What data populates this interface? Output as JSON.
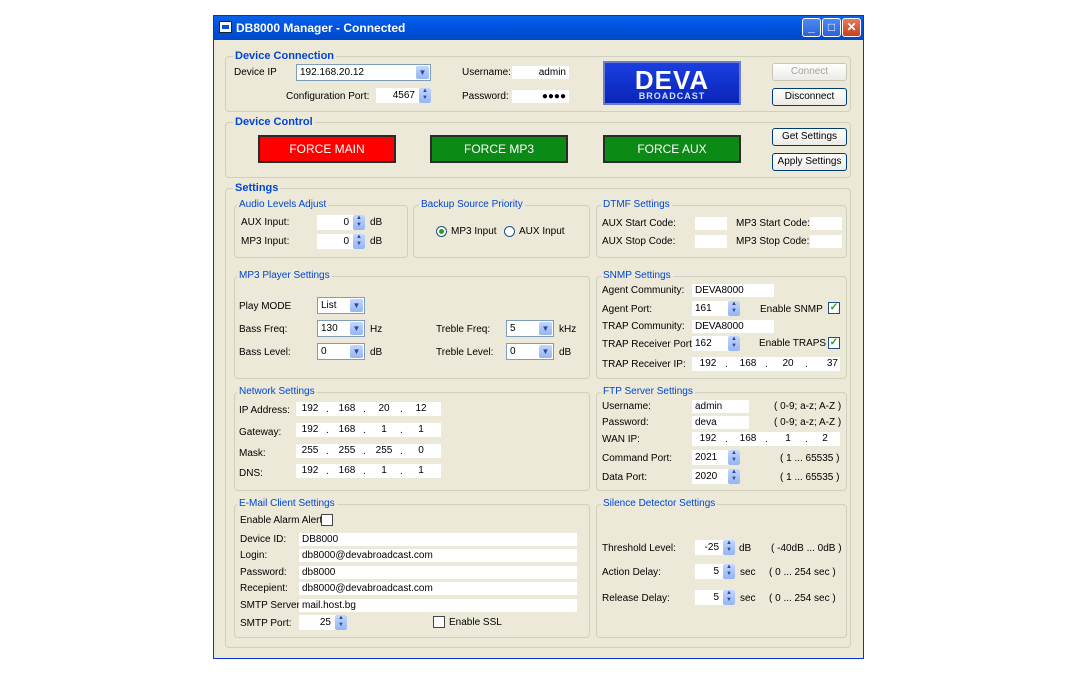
{
  "window": {
    "title": "DB8000 Manager - Connected"
  },
  "connection": {
    "heading": "Device Connection",
    "device_ip_label": "Device IP",
    "device_ip": "192.168.20.12",
    "config_port_label": "Configuration Port:",
    "config_port": "4567",
    "username_label": "Username:",
    "username": "admin",
    "password_label": "Password:",
    "password": "●●●●",
    "connect": "Connect",
    "disconnect": "Disconnect",
    "logo_main": "DEVA",
    "logo_sub": "BROADCAST"
  },
  "control": {
    "heading": "Device Control",
    "force_main": "FORCE MAIN",
    "force_mp3": "FORCE MP3",
    "force_aux": "FORCE AUX",
    "get_settings": "Get Settings",
    "apply_settings": "Apply Settings",
    "colors": {
      "main": "#ff0000",
      "mp3": "#0c8a16",
      "aux": "#0c8a16"
    }
  },
  "settings": {
    "heading": "Settings"
  },
  "audio": {
    "heading": "Audio Levels Adjust",
    "aux_label": "AUX Input:",
    "aux_value": "0",
    "mp3_label": "MP3 Input:",
    "mp3_value": "0",
    "unit": "dB"
  },
  "backup": {
    "heading": "Backup Source Priority",
    "mp3": "MP3 Input",
    "aux": "AUX Input",
    "selected": "MP3 Input"
  },
  "dtmf": {
    "heading": "DTMF Settings",
    "aux_start": "AUX Start Code:",
    "aux_stop": "AUX Stop Code:",
    "mp3_start": "MP3 Start Code:",
    "mp3_stop": "MP3 Stop Code:"
  },
  "mp3player": {
    "heading": "MP3 Player Settings",
    "play_mode_label": "Play MODE",
    "play_mode": "List",
    "bass_freq_label": "Bass Freq:",
    "bass_freq": "130",
    "bass_freq_unit": "Hz",
    "bass_level_label": "Bass Level:",
    "bass_level": "0",
    "bass_level_unit": "dB",
    "treble_freq_label": "Treble Freq:",
    "treble_freq": "5",
    "treble_freq_unit": "kHz",
    "treble_level_label": "Treble Level:",
    "treble_level": "0",
    "treble_level_unit": "dB"
  },
  "snmp": {
    "heading": "SNMP Settings",
    "agent_community_label": "Agent Community:",
    "agent_community": "DEVA8000",
    "agent_port_label": "Agent Port:",
    "agent_port": "161",
    "enable_snmp": "Enable SNMP",
    "trap_community_label": "TRAP Community:",
    "trap_community": "DEVA8000",
    "trap_port_label": "TRAP Receiver Port:",
    "trap_port": "162",
    "enable_traps": "Enable TRAPS",
    "trap_ip_label": "TRAP Receiver IP:",
    "trap_ip": [
      "192",
      "168",
      "20",
      "37"
    ]
  },
  "network": {
    "heading": "Network Settings",
    "ip_label": "IP Address:",
    "ip": [
      "192",
      "168",
      "20",
      "12"
    ],
    "gw_label": "Gateway:",
    "gw": [
      "192",
      "168",
      "1",
      "1"
    ],
    "mask_label": "Mask:",
    "mask": [
      "255",
      "255",
      "255",
      "0"
    ],
    "dns_label": "DNS:",
    "dns": [
      "192",
      "168",
      "1",
      "1"
    ]
  },
  "ftp": {
    "heading": "FTP Server Settings",
    "username_label": "Username:",
    "username": "admin",
    "username_hint": "( 0-9; a-z; A-Z )",
    "password_label": "Password:",
    "password": "deva",
    "password_hint": "( 0-9; a-z; A-Z )",
    "wan_label": "WAN IP:",
    "wan": [
      "192",
      "168",
      "1",
      "2"
    ],
    "cmd_port_label": "Command Port:",
    "cmd_port": "2021",
    "cmd_port_hint": "( 1 ... 65535 )",
    "data_port_label": "Data Port:",
    "data_port": "2020",
    "data_port_hint": "( 1 ... 65535 )"
  },
  "email": {
    "heading": "E-Mail Client Settings",
    "enable_alarm": "Enable Alarm Alert",
    "device_id_label": "Device ID:",
    "device_id": "DB8000",
    "login_label": "Login:",
    "login": "db8000@devabroadcast.com",
    "password_label": "Password:",
    "password": "db8000",
    "recipient_label": "Recepient:",
    "recipient": "db8000@devabroadcast.com",
    "smtp_server_label": "SMTP Server:",
    "smtp_server": "mail.host.bg",
    "smtp_port_label": "SMTP Port:",
    "smtp_port": "25",
    "enable_ssl": "Enable SSL"
  },
  "silence": {
    "heading": "Silence Detector Settings",
    "threshold_label": "Threshold Level:",
    "threshold": "-25",
    "threshold_unit": "dB",
    "threshold_hint": "( -40dB ... 0dB )",
    "action_label": "Action Delay:",
    "action": "5",
    "action_unit": "sec",
    "action_hint": "( 0 ... 254 sec )",
    "release_label": "Release Delay:",
    "release": "5",
    "release_unit": "sec",
    "release_hint": "( 0 ... 254 sec )"
  },
  "icons": [
    "app-icon",
    "minimize-icon",
    "maximize-icon",
    "close-icon",
    "chevron-down-icon",
    "spin-arrows-icon",
    "checkmark-icon"
  ]
}
